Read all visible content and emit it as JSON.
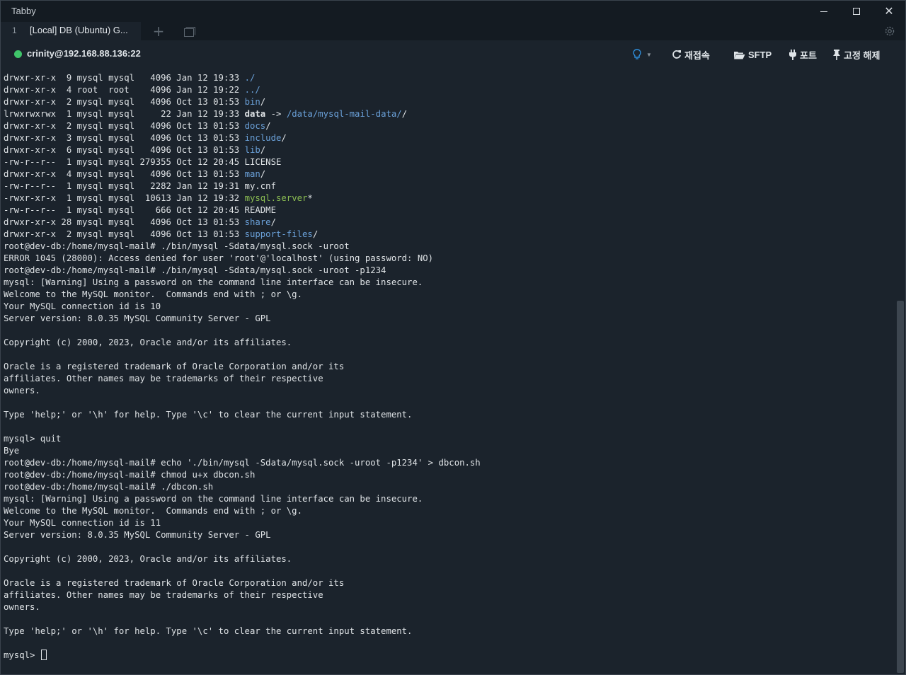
{
  "window": {
    "app_title": "Tabby"
  },
  "tabs": [
    {
      "index": "1",
      "title": "[Local] DB (Ubuntu) G..."
    }
  ],
  "toolbar": {
    "host": "crinity@192.168.88.136:22",
    "status_color": "#3fc46a",
    "reconnect_label": "재접속",
    "sftp_label": "SFTP",
    "ports_label": "포트",
    "unpin_label": "고정 해제"
  },
  "terminal": {
    "lines": [
      [
        {
          "t": "drwxr-xr-x  9 mysql mysql   4096 Jan 12 19:33 "
        },
        {
          "t": "./",
          "c": "blue"
        }
      ],
      [
        {
          "t": "drwxr-xr-x  4 root  root    4096 Jan 12 19:22 "
        },
        {
          "t": "../",
          "c": "blue"
        }
      ],
      [
        {
          "t": "drwxr-xr-x  2 mysql mysql   4096 Oct 13 01:53 "
        },
        {
          "t": "bin",
          "c": "blue"
        },
        {
          "t": "/"
        }
      ],
      [
        {
          "t": "lrwxrwxrwx  1 mysql mysql     22 Jan 12 19:33 "
        },
        {
          "t": "data",
          "c": "bold"
        },
        {
          "t": " -> "
        },
        {
          "t": "/data/mysql-mail-data/",
          "c": "blue"
        },
        {
          "t": "/"
        }
      ],
      [
        {
          "t": "drwxr-xr-x  2 mysql mysql   4096 Oct 13 01:53 "
        },
        {
          "t": "docs",
          "c": "blue"
        },
        {
          "t": "/"
        }
      ],
      [
        {
          "t": "drwxr-xr-x  3 mysql mysql   4096 Oct 13 01:53 "
        },
        {
          "t": "include",
          "c": "blue"
        },
        {
          "t": "/"
        }
      ],
      [
        {
          "t": "drwxr-xr-x  6 mysql mysql   4096 Oct 13 01:53 "
        },
        {
          "t": "lib",
          "c": "blue"
        },
        {
          "t": "/"
        }
      ],
      [
        {
          "t": "-rw-r--r--  1 mysql mysql 279355 Oct 12 20:45 LICENSE"
        }
      ],
      [
        {
          "t": "drwxr-xr-x  4 mysql mysql   4096 Oct 13 01:53 "
        },
        {
          "t": "man",
          "c": "blue"
        },
        {
          "t": "/"
        }
      ],
      [
        {
          "t": "-rw-r--r--  1 mysql mysql   2282 Jan 12 19:31 my.cnf"
        }
      ],
      [
        {
          "t": "-rwxr-xr-x  1 mysql mysql  10613 Jan 12 19:32 "
        },
        {
          "t": "mysql.server",
          "c": "green"
        },
        {
          "t": "*"
        }
      ],
      [
        {
          "t": "-rw-r--r--  1 mysql mysql    666 Oct 12 20:45 README"
        }
      ],
      [
        {
          "t": "drwxr-xr-x 28 mysql mysql   4096 Oct 13 01:53 "
        },
        {
          "t": "share",
          "c": "blue"
        },
        {
          "t": "/"
        }
      ],
      [
        {
          "t": "drwxr-xr-x  2 mysql mysql   4096 Oct 13 01:53 "
        },
        {
          "t": "support-files",
          "c": "blue"
        },
        {
          "t": "/"
        }
      ],
      [
        {
          "t": "root@dev-db:/home/mysql-mail# ./bin/mysql -Sdata/mysql.sock -uroot"
        }
      ],
      [
        {
          "t": "ERROR 1045 (28000): Access denied for user 'root'@'localhost' (using password: NO)"
        }
      ],
      [
        {
          "t": "root@dev-db:/home/mysql-mail# ./bin/mysql -Sdata/mysql.sock -uroot -p1234"
        }
      ],
      [
        {
          "t": "mysql: [Warning] Using a password on the command line interface can be insecure."
        }
      ],
      [
        {
          "t": "Welcome to the MySQL monitor.  Commands end with ; or \\g."
        }
      ],
      [
        {
          "t": "Your MySQL connection id is 10"
        }
      ],
      [
        {
          "t": "Server version: 8.0.35 MySQL Community Server - GPL"
        }
      ],
      [],
      [
        {
          "t": "Copyright (c) 2000, 2023, Oracle and/or its affiliates."
        }
      ],
      [],
      [
        {
          "t": "Oracle is a registered trademark of Oracle Corporation and/or its"
        }
      ],
      [
        {
          "t": "affiliates. Other names may be trademarks of their respective"
        }
      ],
      [
        {
          "t": "owners."
        }
      ],
      [],
      [
        {
          "t": "Type 'help;' or '\\h' for help. Type '\\c' to clear the current input statement."
        }
      ],
      [],
      [
        {
          "t": "mysql> quit"
        }
      ],
      [
        {
          "t": "Bye"
        }
      ],
      [
        {
          "t": "root@dev-db:/home/mysql-mail# echo './bin/mysql -Sdata/mysql.sock -uroot -p1234' > dbcon.sh"
        }
      ],
      [
        {
          "t": "root@dev-db:/home/mysql-mail# chmod u+x dbcon.sh"
        }
      ],
      [
        {
          "t": "root@dev-db:/home/mysql-mail# ./dbcon.sh"
        }
      ],
      [
        {
          "t": "mysql: [Warning] Using a password on the command line interface can be insecure."
        }
      ],
      [
        {
          "t": "Welcome to the MySQL monitor.  Commands end with ; or \\g."
        }
      ],
      [
        {
          "t": "Your MySQL connection id is 11"
        }
      ],
      [
        {
          "t": "Server version: 8.0.35 MySQL Community Server - GPL"
        }
      ],
      [],
      [
        {
          "t": "Copyright (c) 2000, 2023, Oracle and/or its affiliates."
        }
      ],
      [],
      [
        {
          "t": "Oracle is a registered trademark of Oracle Corporation and/or its"
        }
      ],
      [
        {
          "t": "affiliates. Other names may be trademarks of their respective"
        }
      ],
      [
        {
          "t": "owners."
        }
      ],
      [],
      [
        {
          "t": "Type 'help;' or '\\h' for help. Type '\\c' to clear the current input statement."
        }
      ],
      []
    ],
    "prompt": "mysql> ",
    "colors": {
      "foreground": "#dfe3e6",
      "background": "#1b232c",
      "directory": "#6aa0d8",
      "executable": "#8bbd52"
    }
  }
}
